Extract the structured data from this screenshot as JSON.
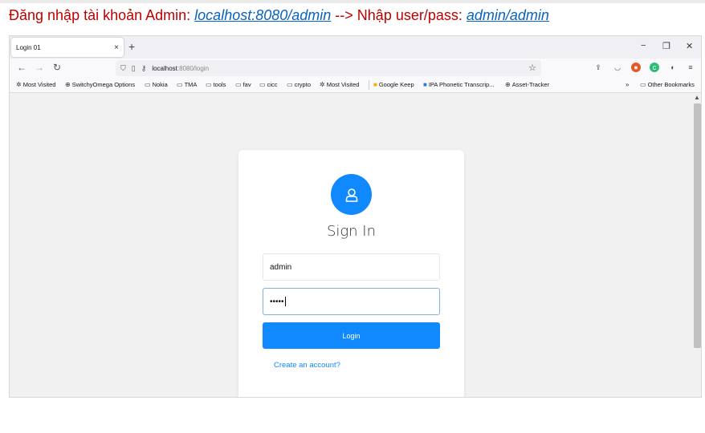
{
  "caption": {
    "prefix": "Đăng nhập tài khoản Admin: ",
    "url": "localhost:8080/admin",
    "mid": " --> Nhập user/pass: ",
    "creds": "admin/admin"
  },
  "browser": {
    "tab_title": "Login 01",
    "tab_close": "×",
    "new_tab": "+",
    "window_controls": {
      "minimize": "−",
      "restore": "❐",
      "close": "✕"
    },
    "url_host": "localhost",
    "url_path": ":8080/login",
    "bookmarks": [
      {
        "label": "Most Visited",
        "icon": "gear-icon"
      },
      {
        "label": "SwitchyOmega Options",
        "icon": "globe-icon"
      },
      {
        "label": "Nokia",
        "icon": "folder-icon"
      },
      {
        "label": "TMA",
        "icon": "folder-icon"
      },
      {
        "label": "tools",
        "icon": "folder-icon"
      },
      {
        "label": "fav",
        "icon": "folder-icon"
      },
      {
        "label": "cicc",
        "icon": "folder-icon"
      },
      {
        "label": "crypto",
        "icon": "folder-icon"
      },
      {
        "label": "Most Visited",
        "icon": "gear-icon"
      },
      {
        "label": "Google Keep",
        "icon": "keep-icon"
      },
      {
        "label": "IPA Phonetic Transcrip...",
        "icon": "ipa-icon"
      },
      {
        "label": "Asset-Tracker",
        "icon": "globe-icon"
      }
    ],
    "other_bookmarks": "Other Bookmarks"
  },
  "login": {
    "title": "Sign In",
    "username_value": "admin",
    "password_mask": "•••••",
    "login_button": "Login",
    "create_account": "Create an account?"
  },
  "colors": {
    "accent": "#1089ff",
    "caption_red": "#c00000",
    "caption_link": "#0563c1"
  }
}
